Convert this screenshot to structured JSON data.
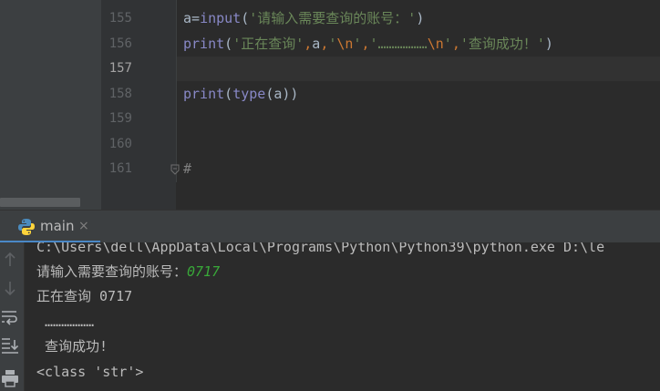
{
  "editor": {
    "lines": [
      {
        "num": "155",
        "current": false
      },
      {
        "num": "156",
        "current": false
      },
      {
        "num": "157",
        "current": true
      },
      {
        "num": "158",
        "current": false
      },
      {
        "num": "159",
        "current": false
      },
      {
        "num": "160",
        "current": false
      },
      {
        "num": "161",
        "current": false
      }
    ],
    "code": {
      "l155": {
        "var": "a",
        "eq": "=",
        "func": "input",
        "open": "(",
        "str": "'请输入需要查询的账号：'",
        "close": ")"
      },
      "l156": {
        "func": "print",
        "open": "(",
        "s1": "'正在查询'",
        "c1": ",",
        "a": "a",
        "c2": ",",
        "q3": "'",
        "esc1": "\\n",
        "q3b": "'",
        "c3": ",",
        "q4": "'………………",
        "esc2": "\\n",
        "q4b": "'",
        "c4": ",",
        "s5": "'查询成功！'",
        "close": ")"
      },
      "l158": {
        "func": "print",
        "open": "(",
        "func2": "type",
        "inner": "(a))"
      },
      "l161": {
        "text": "#"
      }
    }
  },
  "run": {
    "tab_label": "main",
    "tab_close": "×",
    "console": {
      "cmd": "C:\\Users\\dell\\AppData\\Local\\Programs\\Python\\Python39\\python.exe D:\\le",
      "prompt": "请输入需要查询的账号：",
      "input": "0717",
      "line3": "正在查询 0717",
      "line4": " ………………",
      "line5": " 查询成功!",
      "line6": "<class 'str'>"
    }
  },
  "icons": {
    "run_tab": "python-icon",
    "side": [
      "up-arrow-icon",
      "down-arrow-icon",
      "soft-wrap-icon",
      "scroll-to-end-icon",
      "print-icon"
    ],
    "fold": "fold-marker-icon"
  },
  "colors": {
    "accent": "#4a88c7",
    "string": "#6a8759",
    "escape": "#cc7832",
    "builtin": "#8888c6",
    "console_input": "#39a839"
  }
}
